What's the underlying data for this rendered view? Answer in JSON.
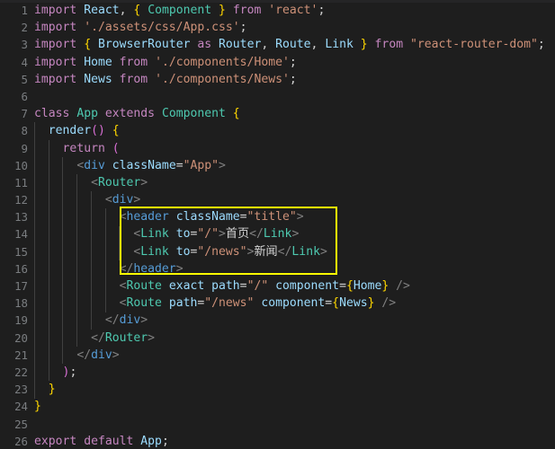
{
  "editor": {
    "theme_background": "#1e1e1e",
    "gutter_color": "#7a7d80",
    "highlight_color": "#ffff00",
    "language": "javascript-react-jsx"
  },
  "highlight_box": {
    "label": "annotation-rectangle",
    "color": "#ffff00",
    "covers_lines": "13-16"
  },
  "lines": [
    {
      "num": "1",
      "text": "import React, { Component } from 'react';"
    },
    {
      "num": "2",
      "text": "import './assets/css/App.css';"
    },
    {
      "num": "3",
      "text": "import { BrowserRouter as Router, Route, Link } from \"react-router-dom\";"
    },
    {
      "num": "4",
      "text": "import Home from './components/Home';"
    },
    {
      "num": "5",
      "text": "import News from './components/News';"
    },
    {
      "num": "6",
      "text": ""
    },
    {
      "num": "7",
      "text": "class App extends Component {"
    },
    {
      "num": "8",
      "text": "  render() {"
    },
    {
      "num": "9",
      "text": "    return ("
    },
    {
      "num": "10",
      "text": "      <div className=\"App\">"
    },
    {
      "num": "11",
      "text": "        <Router>"
    },
    {
      "num": "12",
      "text": "          <div>"
    },
    {
      "num": "13",
      "text": "            <header className=\"title\">"
    },
    {
      "num": "14",
      "text": "              <Link to=\"/\">首页</Link>"
    },
    {
      "num": "15",
      "text": "              <Link to=\"/news\">新闻</Link>"
    },
    {
      "num": "16",
      "text": "            </header>"
    },
    {
      "num": "17",
      "text": "            <Route exact path=\"/\" component={Home} />"
    },
    {
      "num": "18",
      "text": "            <Route path=\"/news\" component={News} />"
    },
    {
      "num": "19",
      "text": "          </div>"
    },
    {
      "num": "20",
      "text": "        </Router>"
    },
    {
      "num": "21",
      "text": "      </div>"
    },
    {
      "num": "22",
      "text": "    );"
    },
    {
      "num": "23",
      "text": "  }"
    },
    {
      "num": "24",
      "text": "}"
    },
    {
      "num": "25",
      "text": ""
    },
    {
      "num": "26",
      "text": "export default App;"
    }
  ]
}
